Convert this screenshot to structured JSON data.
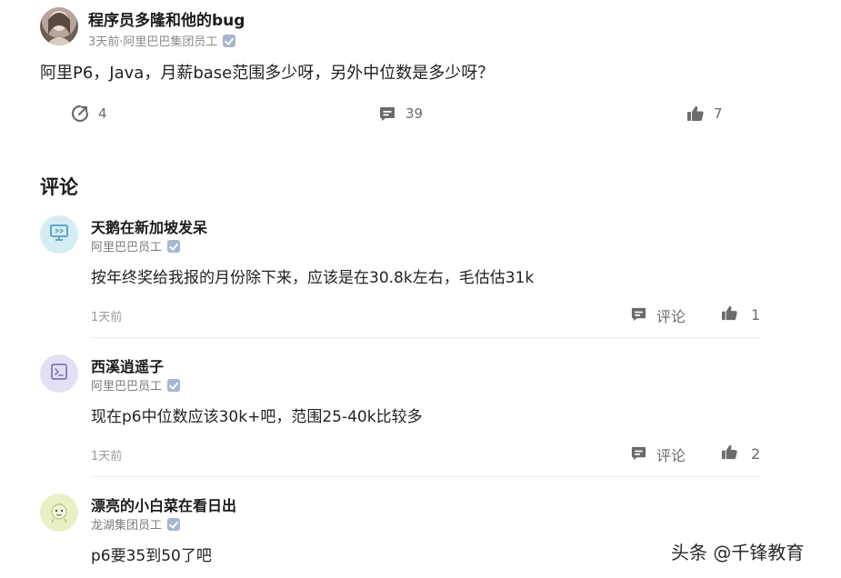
{
  "post": {
    "author": "程序员多隆和他的bug",
    "meta": "3天前·阿里巴巴集团员工",
    "text": "阿里P6，Java，月薪base范围多少呀，另外中位数是多少呀？",
    "actions": {
      "share_count": "4",
      "comment_count": "39",
      "like_count": "7"
    }
  },
  "comments_section": {
    "title": "评论",
    "reply_label": "评论",
    "items": [
      {
        "name": "天鹅在新加坡发呆",
        "org": "阿里巴巴员工",
        "text": "按年终奖给我报的月份除下来，应该是在30.8k左右，毛估估31k",
        "time": "1天前",
        "likes": "1",
        "avatar_icon": "monitor-icon",
        "avatar_color": "#d6ecf3"
      },
      {
        "name": "西溪逍遥子",
        "org": "阿里巴巴员工",
        "text": "现在p6中位数应该30k+吧，范围25-40k比较多",
        "time": "1天前",
        "likes": "2",
        "avatar_icon": "terminal-icon",
        "avatar_color": "#e4e0f3"
      },
      {
        "name": "漂亮的小白菜在看日出",
        "org": "龙湖集团员工",
        "text": "p6要35到50了吧",
        "avatar_icon": "cartoon-face-icon",
        "avatar_color": "#e9f0c8"
      }
    ]
  },
  "watermark": "头条 @千锋教育",
  "colors": {
    "verified_badge": "#a6b6cf",
    "icon_gray": "#6b6b6b"
  }
}
